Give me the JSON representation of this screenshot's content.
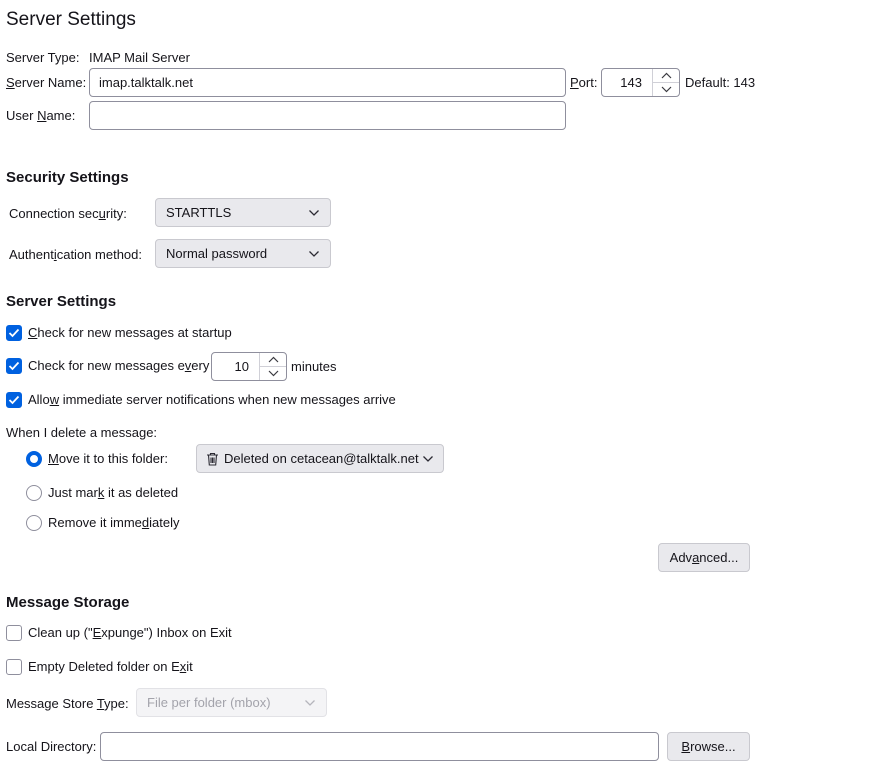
{
  "server_settings": {
    "title": "Server Settings",
    "server_type_label": "Server Type:",
    "server_type_value": "IMAP Mail Server",
    "server_name_label_pre": "",
    "server_name_label_key": "S",
    "server_name_label_post": "erver Name:",
    "server_name_value": "imap.talktalk.net",
    "port_label_key": "P",
    "port_label_post": "ort:",
    "port_value": "143",
    "default_label": "Default: 143",
    "user_name_label_pre": "User ",
    "user_name_label_key": "N",
    "user_name_label_post": "ame:",
    "user_name_value": ""
  },
  "security": {
    "title": "Security Settings",
    "connection_label_pre": "Connection sec",
    "connection_label_key": "u",
    "connection_label_post": "rity:",
    "connection_value": "STARTTLS",
    "auth_label_pre": "Authent",
    "auth_label_key": "i",
    "auth_label_post": "cation method:",
    "auth_value": "Normal password"
  },
  "server_options": {
    "title": "Server Settings",
    "check_startup_key": "C",
    "check_startup_post": "heck for new messages at startup",
    "check_startup_checked": true,
    "check_every_pre": "Check for new messages e",
    "check_every_key": "v",
    "check_every_post": "ery",
    "check_every_value": "10",
    "minutes_label": "minutes",
    "check_every_checked": true,
    "allow_pre": "Allo",
    "allow_key": "w",
    "allow_post": " immediate server notifications when new messages arrive",
    "allow_checked": true,
    "delete_label": "When I delete a message:",
    "move_key": "M",
    "move_post": "ove it to this folder:",
    "move_selected": true,
    "folder_value": "Deleted on cetacean@talktalk.net",
    "mark_pre": "Just mar",
    "mark_key": "k",
    "mark_post": " it as deleted",
    "remove_pre": "Remove it imme",
    "remove_key": "d",
    "remove_post": "iately",
    "advanced_pre": "Adv",
    "advanced_key": "a",
    "advanced_post": "nced..."
  },
  "storage": {
    "title": "Message Storage",
    "cleanup_pre": "Clean up (\"",
    "cleanup_key": "E",
    "cleanup_post": "xpunge\") Inbox on Exit",
    "cleanup_checked": false,
    "empty_pre": "Empty Deleted folder on E",
    "empty_key": "x",
    "empty_post": "it",
    "empty_checked": false,
    "store_type_pre": "Message Store ",
    "store_type_key": "T",
    "store_type_post": "ype:",
    "store_type_value": "File per folder (mbox)",
    "local_dir_label": "Local Directory:",
    "local_dir_value": "",
    "browse_key": "B",
    "browse_post": "rowse..."
  },
  "colors": {
    "accent": "#0061e0",
    "text": "#15141a",
    "border": "#8f8f9d",
    "button_bg": "#e9e9ed"
  },
  "icons": [
    "checkmark-icon",
    "chevron-down-icon",
    "chevron-up-icon",
    "trash-icon"
  ]
}
